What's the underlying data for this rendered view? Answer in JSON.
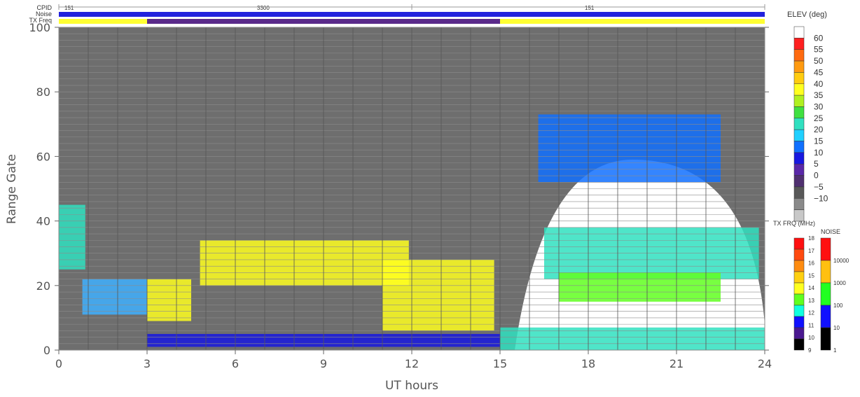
{
  "chart_data": {
    "type": "heatmap",
    "title": "",
    "xlabel": "UT hours",
    "ylabel": "Range Gate",
    "x_ticks": [
      "0",
      "3",
      "6",
      "9",
      "12",
      "15",
      "18",
      "21",
      "24"
    ],
    "y_ticks": [
      "0",
      "20",
      "40",
      "60",
      "80",
      "100"
    ],
    "xlim": [
      0,
      24
    ],
    "ylim": [
      0,
      100
    ],
    "background_color": "#6e6e6e",
    "header": {
      "row_labels": [
        "CPID",
        "Noise",
        "TX Freq"
      ],
      "cpid_segments": [
        {
          "start": 0,
          "end": 12,
          "label": "151"
        },
        {
          "start": 12,
          "end": 24,
          "label": "151"
        }
      ],
      "cpid_mid_label": "3300",
      "tx_freq_segments": [
        {
          "start": 0,
          "end": 3,
          "color": "#ffff33"
        },
        {
          "start": 3,
          "end": 15,
          "color": "#5a2a8a"
        },
        {
          "start": 15,
          "end": 24,
          "color": "#ffff33"
        }
      ]
    },
    "elevation_colorbar": {
      "label": "ELEV (deg)",
      "ticks": [
        "60",
        "55",
        "50",
        "45",
        "40",
        "35",
        "30",
        "25",
        "20",
        "15",
        "10",
        "5",
        "0",
        "−5",
        "−10"
      ],
      "colors": [
        "#ffffff",
        "#ff2020",
        "#ff6a10",
        "#ff9a10",
        "#ffcc10",
        "#ffff20",
        "#b0f020",
        "#40e040",
        "#30e0c0",
        "#20d0ff",
        "#1070ff",
        "#1818e0",
        "#5a28a8",
        "#503070",
        "#585858",
        "#8a8a8a",
        "#c8c8c8"
      ]
    },
    "txfreq_colorbar": {
      "label": "TX FRQ (MHz)",
      "ticks": [
        "18",
        "17",
        "16",
        "15",
        "14",
        "13",
        "12",
        "11",
        "10",
        "9"
      ],
      "colors": [
        "#ff1010",
        "#ff4a10",
        "#ff8c10",
        "#ffd010",
        "#ffff20",
        "#60ff20",
        "#10ffe0",
        "#1010ff",
        "#4a1890",
        "#000000"
      ]
    },
    "noise_colorbar": {
      "label": "NOISE",
      "ticks": [
        "10000",
        "1000",
        "100",
        "10",
        "1"
      ],
      "colors": [
        "#ff1010",
        "#ffc010",
        "#20ff20",
        "#1010ff",
        "#000000"
      ]
    },
    "features": [
      {
        "kind": "white",
        "x0": 15.5,
        "x1": 24,
        "y0": 0,
        "y1": 59,
        "shape": "dome",
        "peak_x": 19.5
      },
      {
        "kind": "band",
        "color": "#ffff20",
        "x0": 4.8,
        "x1": 11.9,
        "y0": 20,
        "y1": 34
      },
      {
        "kind": "band",
        "color": "#ffff20",
        "x0": 3.0,
        "x1": 4.5,
        "y0": 9,
        "y1": 22
      },
      {
        "kind": "band",
        "color": "#ffff20",
        "x0": 11.0,
        "x1": 14.8,
        "y0": 6,
        "y1": 28
      },
      {
        "kind": "band",
        "color": "#40b0ff",
        "x0": 0.8,
        "x1": 3.0,
        "y0": 11,
        "y1": 22
      },
      {
        "kind": "band",
        "color": "#30e0c0",
        "x0": 0,
        "x1": 0.9,
        "y0": 25,
        "y1": 45
      },
      {
        "kind": "band",
        "color": "#1818e0",
        "x0": 3.0,
        "x1": 15.0,
        "y0": 1,
        "y1": 5
      },
      {
        "kind": "band",
        "color": "#30e0c0",
        "x0": 16.5,
        "x1": 23.8,
        "y0": 22,
        "y1": 38
      },
      {
        "kind": "band",
        "color": "#60ff20",
        "x0": 17.0,
        "x1": 22.5,
        "y0": 15,
        "y1": 24
      },
      {
        "kind": "band",
        "color": "#30e0c0",
        "x0": 15.0,
        "x1": 24.0,
        "y0": 0,
        "y1": 7
      },
      {
        "kind": "band",
        "color": "#1070ff",
        "x0": 16.3,
        "x1": 22.5,
        "y0": 52,
        "y1": 73
      }
    ]
  }
}
